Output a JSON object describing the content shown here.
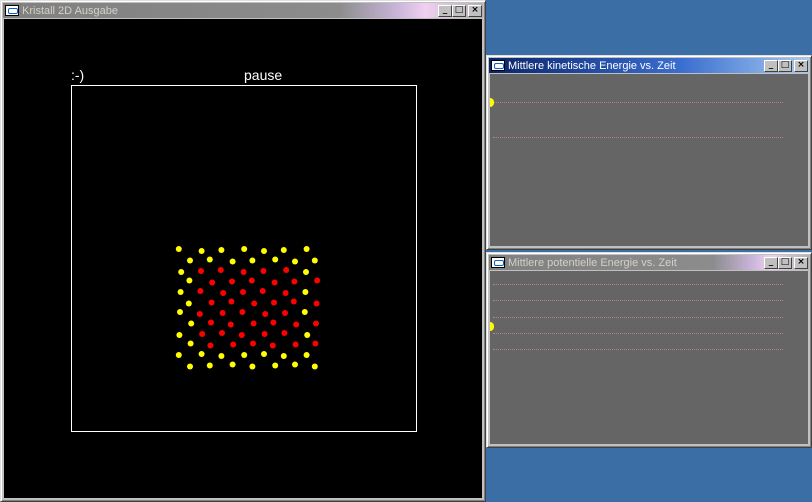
{
  "main_window": {
    "title": "Kristall 2D Ausgabe",
    "smiley": ":-)",
    "status": "pause",
    "particle_colors": {
      "outer": "#ffff00",
      "inner": "#ff0000"
    },
    "lattice": {
      "rows": 12,
      "cols": 7
    }
  },
  "kinetic_window": {
    "title": "Mittlere kinetische Energie vs. Zeit",
    "plot_color": "#c08080",
    "marker_color": "#ffff00"
  },
  "potential_window": {
    "title": "Mittlere potentielle Energie vs. Zeit",
    "plot_color": "#c08080",
    "marker_color": "#ffff00"
  },
  "controls": {
    "minimize": "_",
    "maximize": "□",
    "close": "×"
  }
}
